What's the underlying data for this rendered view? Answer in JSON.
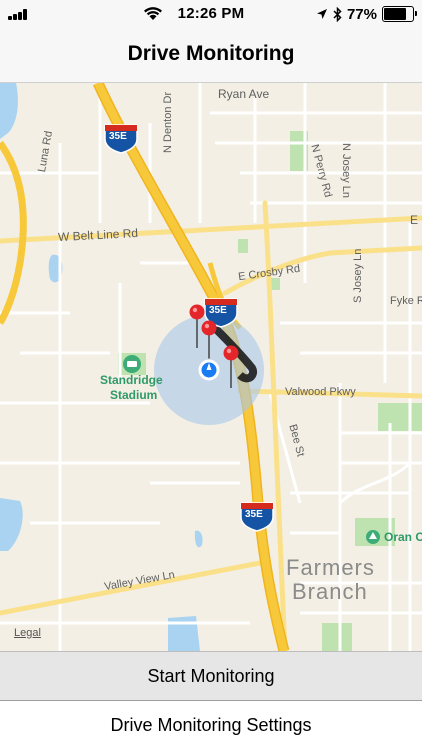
{
  "status_bar": {
    "time": "12:26 PM",
    "battery_percent": "77%",
    "battery_level": 0.77
  },
  "nav": {
    "title": "Drive Monitoring"
  },
  "map": {
    "labels": {
      "ryan_ave": "Ryan Ave",
      "i35e_north": "35E",
      "i35e_mid": "35E",
      "i35e_south": "35E",
      "n_denton_dr": "N Denton Dr",
      "n_josey_ln": "N Josey Ln",
      "n_perry_rd": "N Perry Rd",
      "luna_rd": "Luna Rd",
      "w_belt_line_rd": "W Belt Line Rd",
      "e_label": "E",
      "e_crosby_rd": "E Crosby Rd",
      "fyke": "Fyke R",
      "s_josey_ln": "S Josey Ln",
      "standridge_line1": "Standridge",
      "standridge_line2": "Stadium",
      "valwood_pkwy": "Valwood Pkwy",
      "bee_st": "Bee St",
      "oran": "Oran C",
      "farmers_line1": "Farmers",
      "farmers_line2": "Branch",
      "valley_view_ln": "Valley View Ln",
      "legal": "Legal"
    }
  },
  "actions": {
    "start_label": "Start Monitoring",
    "settings_label": "Drive Monitoring Settings"
  },
  "icons": {
    "signal": "signal-bars-icon",
    "wifi": "wifi-icon",
    "location": "location-arrow-icon",
    "bluetooth": "bluetooth-icon",
    "battery": "battery-icon",
    "user_location": "user-location-icon",
    "pin": "map-pin-icon",
    "park": "park-icon",
    "stadium": "stadium-icon"
  },
  "colors": {
    "map_background": "#f3efe4",
    "highway": "#f7c93a",
    "major_road": "#fbe08a",
    "minor_road": "#ffffff",
    "water": "#a9d3f0",
    "park": "#bfe3b0",
    "accuracy_circle": "#a9c6ea",
    "user_dot": "#1a7cf2",
    "pin_red": "#e4262b",
    "park_icon": "#3dac77"
  }
}
